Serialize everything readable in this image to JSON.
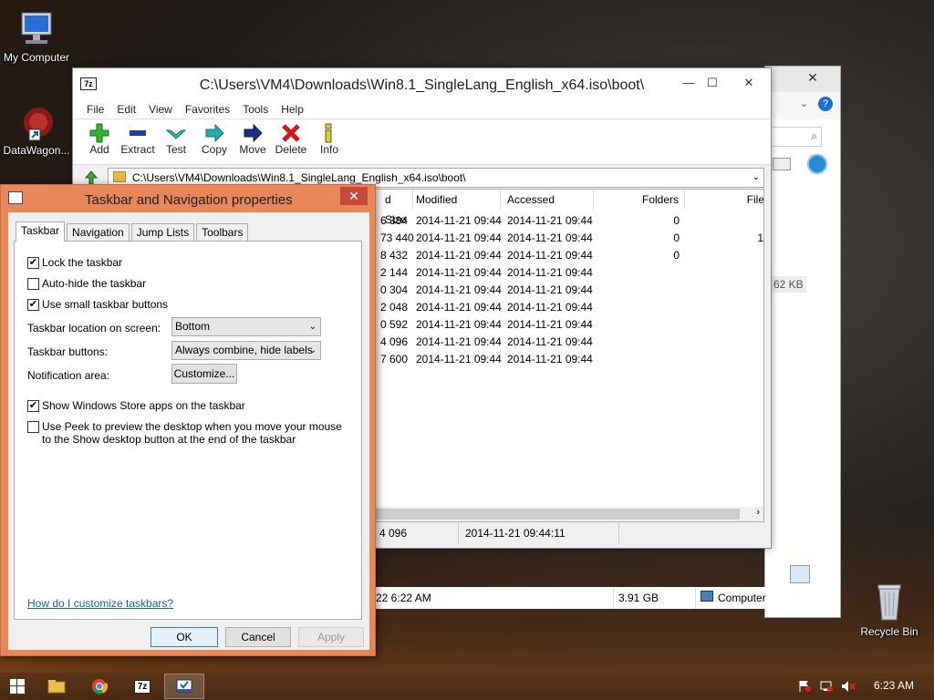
{
  "desktop": {
    "icons": [
      {
        "label": "My Computer"
      },
      {
        "label": "DataWagon..."
      },
      {
        "label": "Recycle Bin"
      }
    ]
  },
  "zip_window": {
    "title": "C:\\Users\\VM4\\Downloads\\Win8.1_SingleLang_English_x64.iso\\boot\\",
    "menu": [
      "File",
      "Edit",
      "View",
      "Favorites",
      "Tools",
      "Help"
    ],
    "toolbar": [
      "Add",
      "Extract",
      "Test",
      "Copy",
      "Move",
      "Delete",
      "Info"
    ],
    "address": "C:\\Users\\VM4\\Downloads\\Win8.1_SingleLang_English_x64.iso\\boot\\",
    "columns": [
      "d Size",
      "Modified",
      "Accessed",
      "Folders",
      "File"
    ],
    "rows": [
      {
        "size": "6 384",
        "modified": "2014-11-21 09:44",
        "accessed": "2014-11-21 09:44",
        "folders": "0",
        "files": ""
      },
      {
        "size": "73 440",
        "modified": "2014-11-21 09:44",
        "accessed": "2014-11-21 09:44",
        "folders": "0",
        "files": "1"
      },
      {
        "size": "8 432",
        "modified": "2014-11-21 09:44",
        "accessed": "2014-11-21 09:44",
        "folders": "0",
        "files": ""
      },
      {
        "size": "2 144",
        "modified": "2014-11-21 09:44",
        "accessed": "2014-11-21 09:44",
        "folders": "",
        "files": ""
      },
      {
        "size": "0 304",
        "modified": "2014-11-21 09:44",
        "accessed": "2014-11-21 09:44",
        "folders": "",
        "files": ""
      },
      {
        "size": "2 048",
        "modified": "2014-11-21 09:44",
        "accessed": "2014-11-21 09:44",
        "folders": "",
        "files": ""
      },
      {
        "size": "0 592",
        "modified": "2014-11-21 09:44",
        "accessed": "2014-11-21 09:44",
        "folders": "",
        "files": ""
      },
      {
        "size": "4 096",
        "modified": "2014-11-21 09:44",
        "accessed": "2014-11-21 09:44",
        "folders": "",
        "files": ""
      },
      {
        "size": "7 600",
        "modified": "2014-11-21 09:44",
        "accessed": "2014-11-21 09:44",
        "folders": "",
        "files": ""
      }
    ],
    "status_size": "4 096",
    "status_date": "2014-11-21 09:44:11"
  },
  "explorer_window": {
    "size_text": "62 KB",
    "status_date": "22 6:22 AM",
    "status_size": "3.91 GB",
    "status_location": "Computer"
  },
  "dialog": {
    "title": "Taskbar and Navigation properties",
    "tabs": [
      "Taskbar",
      "Navigation",
      "Jump Lists",
      "Toolbars"
    ],
    "lock_taskbar": "Lock the taskbar",
    "auto_hide": "Auto-hide the taskbar",
    "small_buttons": "Use small taskbar buttons",
    "location_label": "Taskbar location on screen:",
    "location_value": "Bottom",
    "buttons_label": "Taskbar buttons:",
    "buttons_value": "Always combine, hide labels",
    "notification_label": "Notification area:",
    "customize": "Customize...",
    "store_apps": "Show Windows Store apps on the taskbar",
    "peek": "Use Peek to preview the desktop when you move your mouse to the Show desktop button at the end of the taskbar",
    "help_link": "How do I customize taskbars?",
    "ok": "OK",
    "cancel": "Cancel",
    "apply": "Apply",
    "checks": {
      "lock": "✔",
      "auto_hide": "",
      "small": "✔",
      "store": "✔",
      "peek": ""
    }
  },
  "taskbar": {
    "clock": "6:23 AM",
    "zip_label": "7z"
  }
}
